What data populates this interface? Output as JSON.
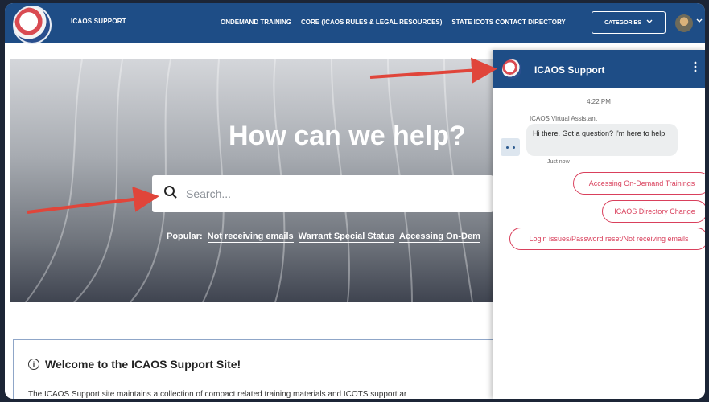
{
  "nav": {
    "site_name": "ICAOS SUPPORT",
    "links": [
      "ONDEMAND TRAINING",
      "CORE (ICAOS RULES & LEGAL RESOURCES)",
      "STATE ICOTS CONTACT DIRECTORY"
    ],
    "categories_label": "CATEGORIES",
    "categories_icon": "chevron-down-icon"
  },
  "hero": {
    "title": "How can we help?",
    "search_placeholder": "Search...",
    "popular_label": "Popular:",
    "popular_links": [
      "Not receiving emails",
      "Warrant Special Status",
      "Accessing On-Dem"
    ]
  },
  "welcome": {
    "title": "Welcome to the ICAOS Support Site!",
    "text": "The ICAOS Support site maintains a collection of compact related training materials and ICOTS support ar"
  },
  "chat": {
    "title": "ICAOS Support",
    "time": "4:22 PM",
    "bot_name": "ICAOS Virtual Assistant",
    "message": "Hi there. Got a question? I'm here to help.",
    "message_time": "Just now",
    "chips": [
      "Accessing On-Demand Trainings",
      "ICAOS Directory Change",
      "Login issues/Password reset/Not receiving emails"
    ]
  },
  "colors": {
    "nav_blue": "#1e4d86",
    "chip_red": "#d9405c",
    "arrow_red": "#e0453a"
  }
}
